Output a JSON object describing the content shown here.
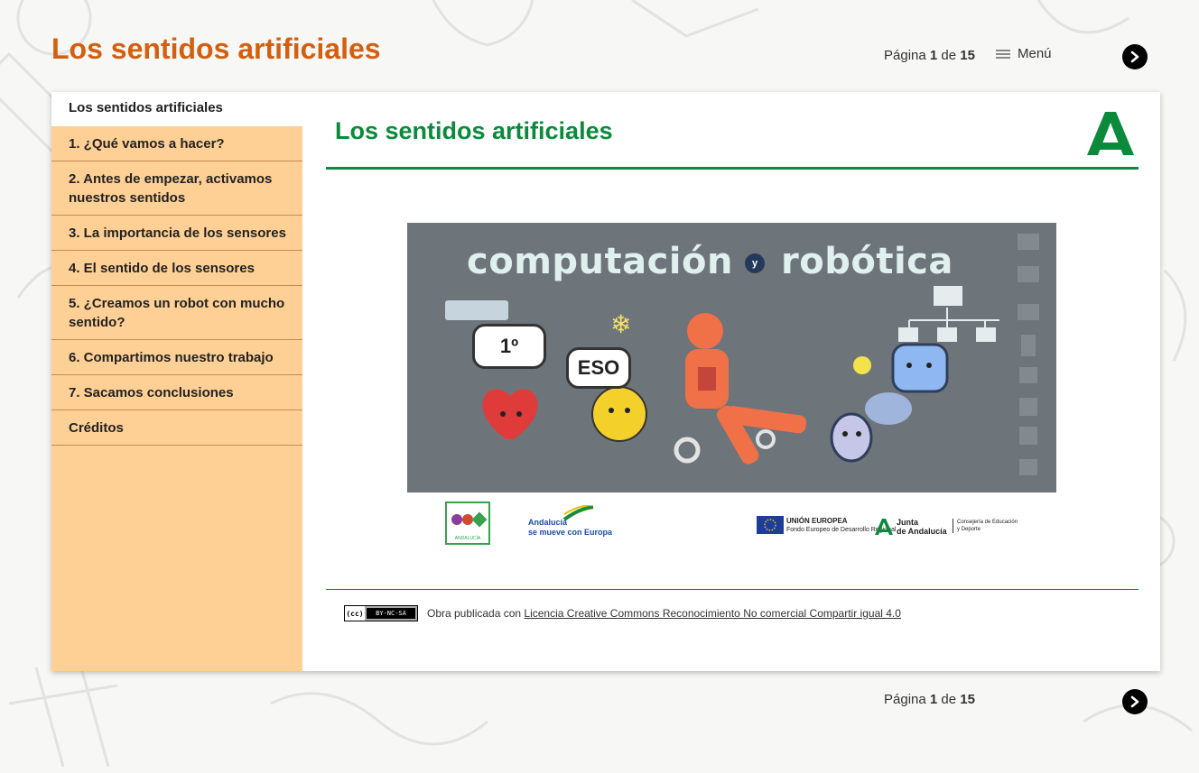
{
  "header": {
    "site_title": "Los sentidos artificiales",
    "pager": {
      "label": "Página",
      "current": "1",
      "of": "de",
      "total": "15"
    },
    "menu_label": "Menú"
  },
  "sidebar": {
    "items": [
      {
        "label": "Los sentidos artificiales",
        "active": true
      },
      {
        "label": "1. ¿Qué vamos a hacer?"
      },
      {
        "label": "2. Antes de empezar, activamos nuestros sentidos"
      },
      {
        "label": "3. La importancia de los sensores"
      },
      {
        "label": "4. El sentido de los sensores"
      },
      {
        "label": "5. ¿Creamos un robot con mucho sentido?"
      },
      {
        "label": "6. Compartimos nuestro trabajo"
      },
      {
        "label": "7. Sacamos conclusiones"
      },
      {
        "label": "Créditos"
      }
    ]
  },
  "main": {
    "heading": "Los sentidos artificiales",
    "hero": {
      "title_left": "computación",
      "title_connector": "y",
      "title_right": "robótica",
      "bubble_1": "1º",
      "bubble_2": "ESO"
    },
    "logos": {
      "rea_text": "ANDALUCÍA",
      "andalucia_europa_1": "Andalucía",
      "andalucia_europa_2": "se mueve con Europa",
      "ue_title": "UNIÓN EUROPEA",
      "ue_subtitle": "Fondo Europeo de Desarrollo Regional",
      "junta_1": "Junta",
      "junta_2": "de Andalucía",
      "consejeria_1": "Consejería de Educación",
      "consejeria_2": "y Deporte"
    },
    "license": {
      "badge_cc": "(cc)",
      "badge_text": "BY-NC-SA",
      "prefix": "Obra publicada con",
      "link_text": "Licencia Creative Commons Reconocimiento No comercial Compartir igual 4.0"
    }
  },
  "footer": {
    "pager": {
      "label": "Página",
      "current": "1",
      "of": "de",
      "total": "15"
    }
  },
  "colors": {
    "title_orange": "#d35f10",
    "heading_green": "#0b8a3c",
    "sidebar_bg": "#ffd095",
    "hero_bg": "#6d757a"
  }
}
